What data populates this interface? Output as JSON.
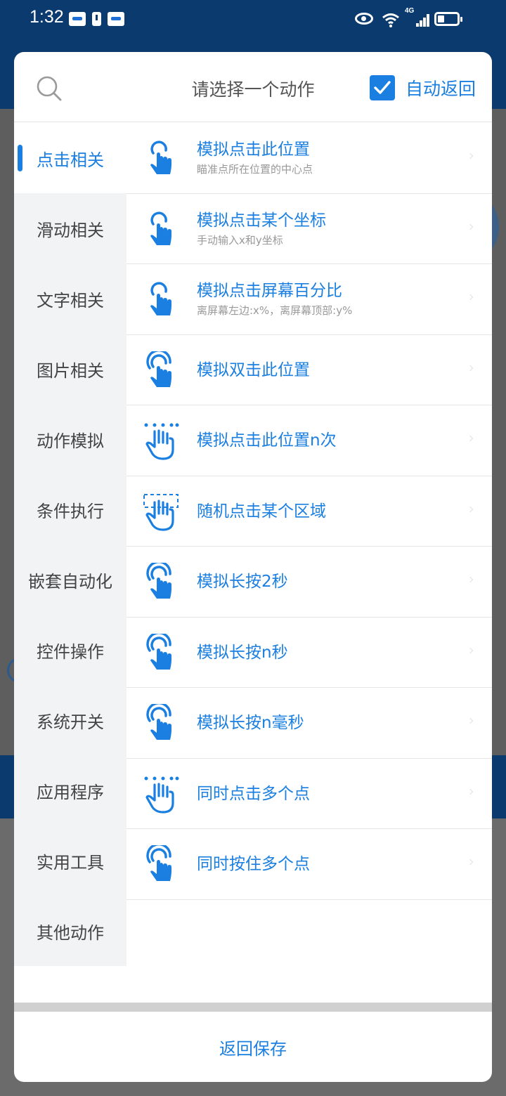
{
  "status_bar": {
    "time": "1:32",
    "network": "4G"
  },
  "dialog": {
    "title": "请选择一个动作",
    "auto_return": {
      "label": "自动返回",
      "checked": true
    },
    "categories": [
      "点击相关",
      "滑动相关",
      "文字相关",
      "图片相关",
      "动作模拟",
      "条件执行",
      "嵌套自动化",
      "控件操作",
      "系统开关",
      "应用程序",
      "实用工具",
      "其他动作"
    ],
    "active_category": "点击相关",
    "actions": [
      {
        "title": "模拟点击此位置",
        "subtitle": "瞄准点所在位置的中心点",
        "icon": "tap-icon"
      },
      {
        "title": "模拟点击某个坐标",
        "subtitle": "手动输入x和y坐标",
        "icon": "tap-icon"
      },
      {
        "title": "模拟点击屏幕百分比",
        "subtitle": "离屏幕左边:x%，离屏幕顶部:y%",
        "icon": "tap-icon"
      },
      {
        "title": "模拟双击此位置",
        "subtitle": "",
        "icon": "double-tap-icon"
      },
      {
        "title": "模拟点击此位置n次",
        "subtitle": "",
        "icon": "multi-tap-icon"
      },
      {
        "title": "随机点击某个区域",
        "subtitle": "",
        "icon": "area-tap-icon"
      },
      {
        "title": "模拟长按2秒",
        "subtitle": "",
        "icon": "long-press-icon"
      },
      {
        "title": "模拟长按n秒",
        "subtitle": "",
        "icon": "long-press-icon"
      },
      {
        "title": "模拟长按n毫秒",
        "subtitle": "",
        "icon": "long-press-icon"
      },
      {
        "title": "同时点击多个点",
        "subtitle": "",
        "icon": "multi-tap-icon"
      },
      {
        "title": "同时按住多个点",
        "subtitle": "",
        "icon": "long-press-icon"
      }
    ],
    "footer_button": "返回保存"
  },
  "colors": {
    "accent": "#1a7fe0",
    "header_bg": "#0a3a6e",
    "sidebar_bg": "#f2f3f5"
  }
}
